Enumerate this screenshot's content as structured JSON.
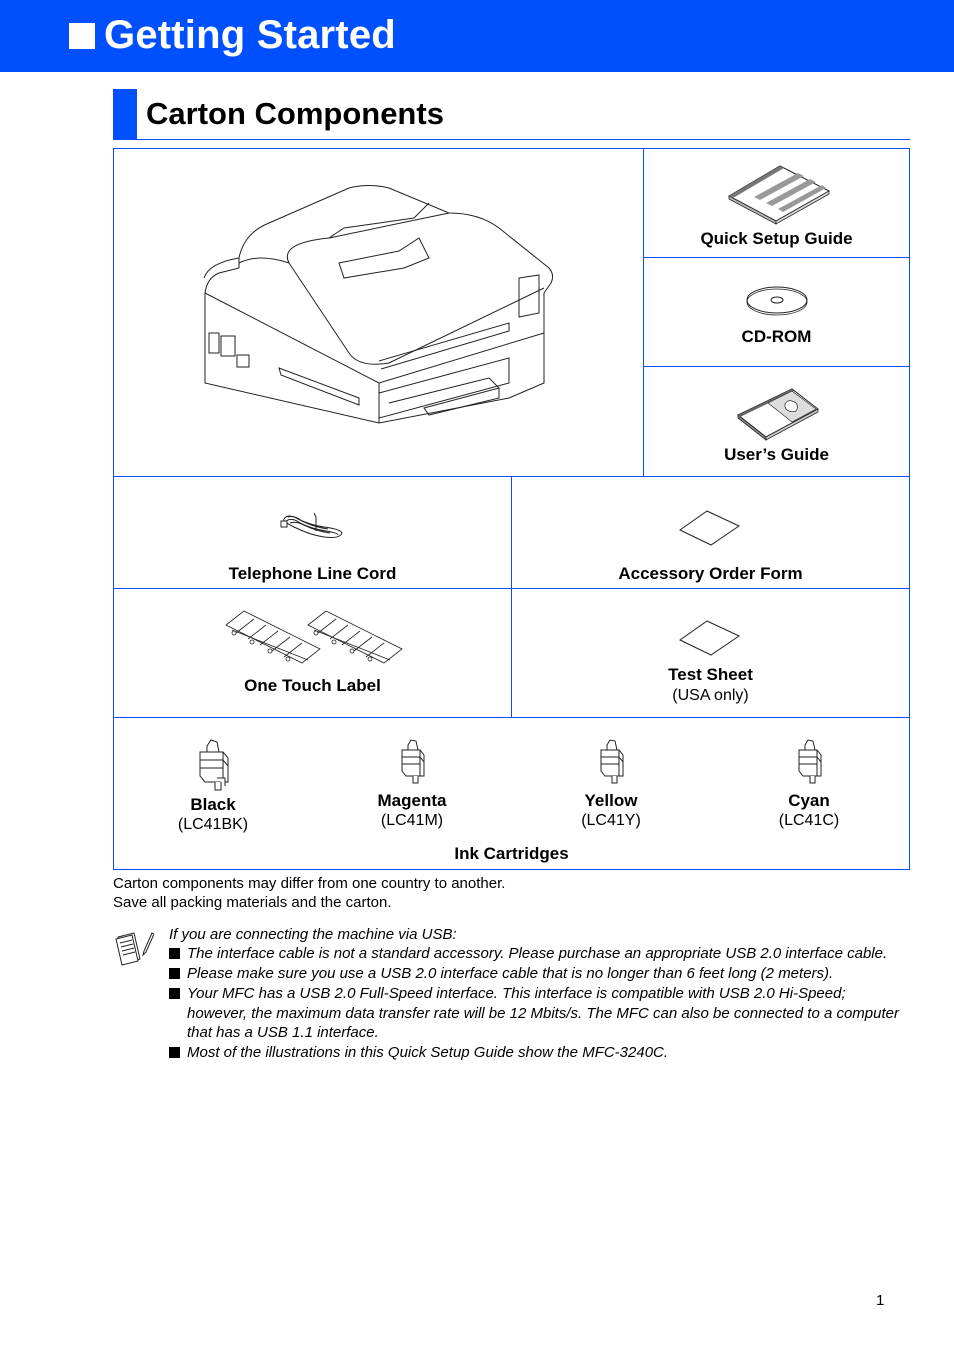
{
  "header": {
    "title": "Getting Started",
    "accent_color": "#0050ff"
  },
  "section": {
    "title": "Carton Components"
  },
  "components": {
    "printer": {
      "icon": "printer-illustration"
    },
    "quick_setup_guide": {
      "label": "Quick Setup Guide",
      "icon": "booklet-icon"
    },
    "cd_rom": {
      "label": "CD-ROM",
      "icon": "cd-icon"
    },
    "users_guide": {
      "label": "User’s Guide",
      "icon": "manual-icon"
    },
    "telephone_line_cord": {
      "label": "Telephone Line Cord",
      "icon": "cord-icon"
    },
    "accessory_order_form": {
      "label": "Accessory Order Form",
      "icon": "sheet-icon"
    },
    "one_touch_label": {
      "label": "One Touch Label",
      "icon": "label-sheet-icon"
    },
    "test_sheet": {
      "label": "Test Sheet",
      "note": "(USA only)",
      "icon": "sheet-icon"
    }
  },
  "ink_cartridges": {
    "label": "Ink Cartridges",
    "items": [
      {
        "name": "Black",
        "code": "(LC41BK)"
      },
      {
        "name": "Magenta",
        "code": "(LC41M)"
      },
      {
        "name": "Yellow",
        "code": "(LC41Y)"
      },
      {
        "name": "Cyan",
        "code": "(LC41C)"
      }
    ]
  },
  "notes": {
    "line1": "Carton components may differ from one country to another.",
    "line2": "Save all packing materials and the carton.",
    "usb_intro": "If you are connecting the machine via USB:",
    "bullets": [
      "The interface cable is not a standard accessory. Please purchase an appropriate USB 2.0 interface cable.",
      "Please make sure you use a USB 2.0 interface cable that is no longer than 6 feet long (2 meters).",
      "Your MFC has a USB 2.0 Full-Speed interface. This interface is compatible with USB 2.0 Hi-Speed; however, the maximum data transfer rate will be 12 Mbits/s. The MFC can also be connected to a computer that has a USB 1.1 interface.",
      "Most of the illustrations in this Quick Setup Guide show the MFC-3240C."
    ]
  },
  "footer": {
    "page_number": "1"
  }
}
